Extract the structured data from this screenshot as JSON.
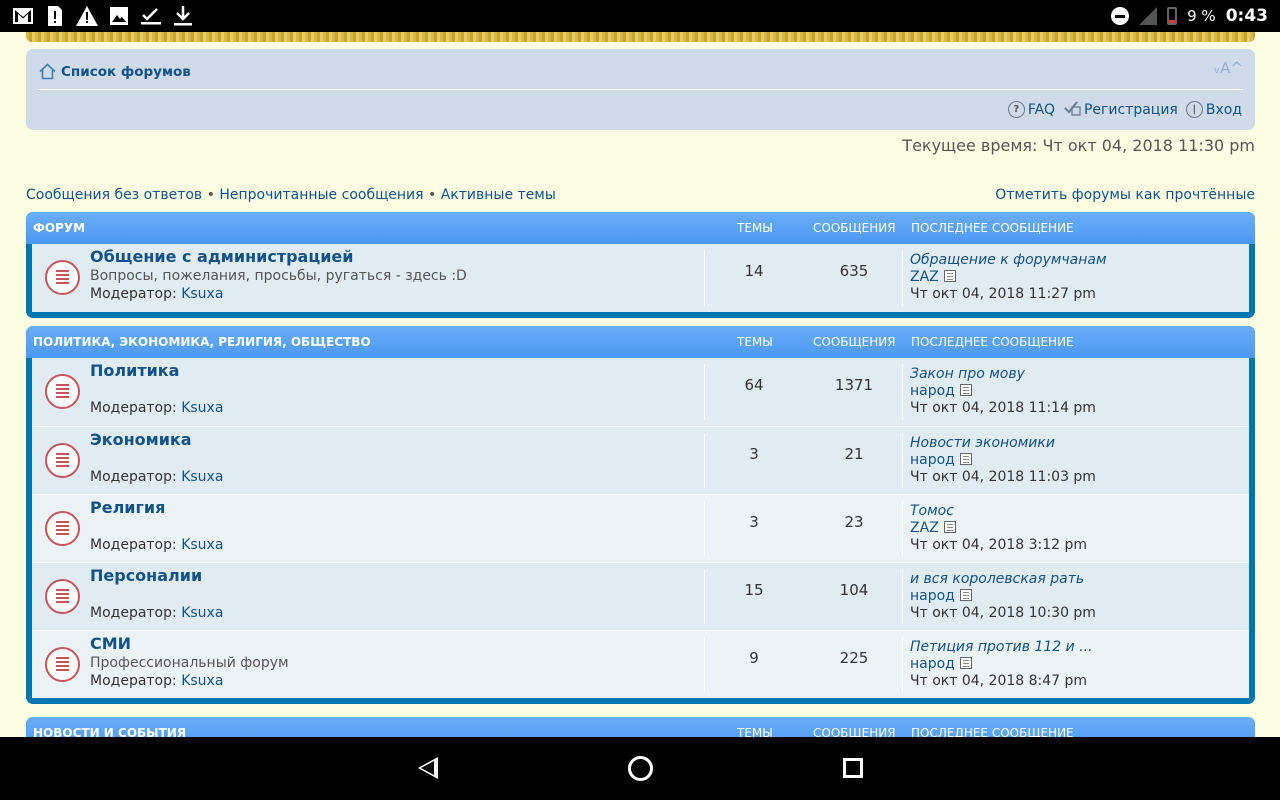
{
  "status_bar": {
    "icons": [
      "gmail-icon",
      "sim-alert-icon",
      "warning-icon",
      "image-icon",
      "checklist-icon",
      "download-icon"
    ],
    "battery": "9 %",
    "time": "0:43"
  },
  "header": {
    "breadcrumb": "Список форумов",
    "font_size": "ᵥA^",
    "links": {
      "faq": "FAQ",
      "register": "Регистрация",
      "login": "Вход"
    }
  },
  "current_time": "Текущее время: Чт окт 04, 2018 11:30 pm",
  "quick_links": {
    "unanswered": "Сообщения без ответов",
    "separator": "•",
    "unread": "Непрочитанные сообщения",
    "active": "Активные темы",
    "mark_read": "Отметить форумы как прочтённые"
  },
  "columns": {
    "topics": "ТЕМЫ",
    "posts": "СООБЩЕНИЯ",
    "last_post": "ПОСЛЕДНЕЕ СООБЩЕНИЕ"
  },
  "moderator_label": "Модератор:",
  "categories": [
    {
      "title": "ФОРУМ",
      "forums": [
        {
          "title": "Общение с администрацией",
          "desc": "Вопросы, пожелания, просьбы, ругаться - здесь :D",
          "moderator": "Ksuxa",
          "topics": "14",
          "posts": "635",
          "last_title": "Обращение к форумчанам",
          "last_author": "ZAZ",
          "last_time": "Чт окт 04, 2018 11:27 pm"
        }
      ]
    },
    {
      "title": "ПОЛИТИКА, ЭКОНОМИКА, РЕЛИГИЯ, ОБЩЕСТВО",
      "forums": [
        {
          "title": "Политика",
          "desc": "",
          "moderator": "Ksuxa",
          "topics": "64",
          "posts": "1371",
          "last_title": "Закон про мову",
          "last_author": "народ",
          "last_time": "Чт окт 04, 2018 11:14 pm"
        },
        {
          "title": "Экономика",
          "desc": "",
          "moderator": "Ksuxa",
          "topics": "3",
          "posts": "21",
          "last_title": "Новости экономики",
          "last_author": "народ",
          "last_time": "Чт окт 04, 2018 11:03 pm"
        },
        {
          "title": "Религия",
          "desc": "",
          "moderator": "Ksuxa",
          "topics": "3",
          "posts": "23",
          "last_title": "Томос",
          "last_author": "ZAZ",
          "last_time": "Чт окт 04, 2018 3:12 pm"
        },
        {
          "title": "Персоналии",
          "desc": "",
          "moderator": "Ksuxa",
          "topics": "15",
          "posts": "104",
          "last_title": "и вся королевская рать",
          "last_author": "народ",
          "last_time": "Чт окт 04, 2018 10:30 pm"
        },
        {
          "title": "СМИ",
          "desc": "Профессиональный форум",
          "moderator": "Ksuxa",
          "topics": "9",
          "posts": "225",
          "last_title": "Петиция против 112 и ...",
          "last_author": "народ",
          "last_time": "Чт окт 04, 2018 8:47 pm"
        }
      ]
    },
    {
      "title": "НОВОСТИ И СОБЫТИЯ",
      "forums": []
    }
  ]
}
